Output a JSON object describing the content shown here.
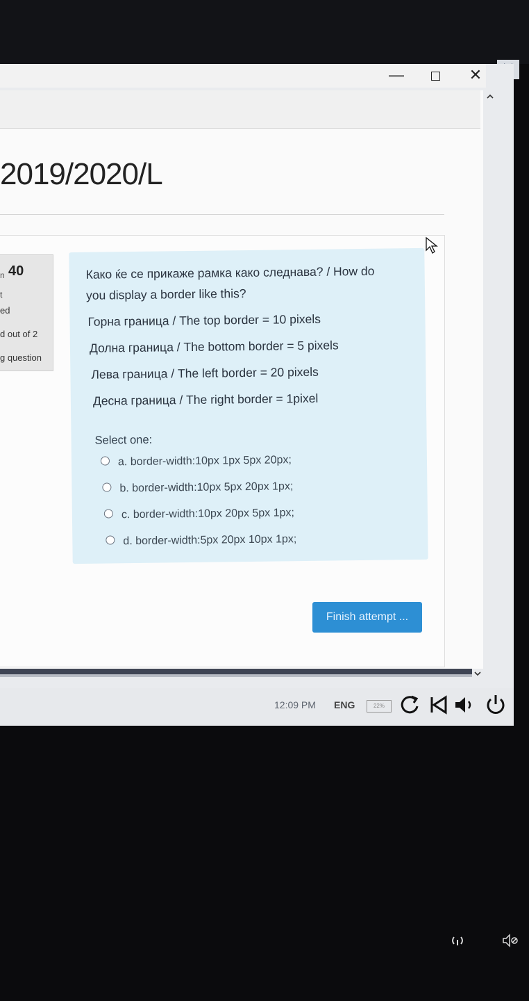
{
  "window": {
    "minimize_glyph": "—",
    "close_glyph": "✕",
    "outer_close_glyph": "✕"
  },
  "course": {
    "title": "2019/2020/L"
  },
  "question_info": {
    "number_prefix": "n",
    "number": "40",
    "line1": "t",
    "status": "ed",
    "marks": "d out of 2",
    "flag": "g question"
  },
  "question": {
    "prompt_line1": "Како ќе се прикаже рамка како следнава? / How do",
    "prompt_line2": "you display a border like this?",
    "top_border": "Горна граница / The top border = 10 pixels",
    "bottom_border": "Долна граница / The bottom border = 5 pixels",
    "left_border": "Лева граница / The left border = 20 pixels",
    "right_border": "Десна граница / The right border = 1pixel",
    "select_label": "Select one:",
    "options": [
      {
        "label": "a. border-width:10px 1px 5px 20px;",
        "selected": false
      },
      {
        "label": "b. border-width:10px 5px 20px 1px;",
        "selected": false
      },
      {
        "label": "c. border-width:10px 20px 5px 1px;",
        "selected": false
      },
      {
        "label": "d. border-width:5px 20px 10px 1px;",
        "selected": false
      }
    ]
  },
  "actions": {
    "finish_attempt": "Finish attempt ..."
  },
  "taskbar": {
    "time": "12:09 PM",
    "language": "ENG",
    "battery": "22%"
  },
  "icons": {
    "minimize": "minimize-icon",
    "maximize": "maximize-icon",
    "close": "close-icon",
    "scroll_up": "chevron-up-icon",
    "scroll_down": "chevron-down-icon",
    "cursor": "mouse-cursor-icon",
    "refresh": "refresh-icon",
    "back": "skip-back-icon",
    "volume": "volume-icon",
    "power": "power-icon",
    "phone_signal": "wifi-call-icon",
    "phone_sound": "sound-off-icon"
  },
  "colors": {
    "question_bg": "#def0f8",
    "finish_button": "#2d8fd4"
  }
}
